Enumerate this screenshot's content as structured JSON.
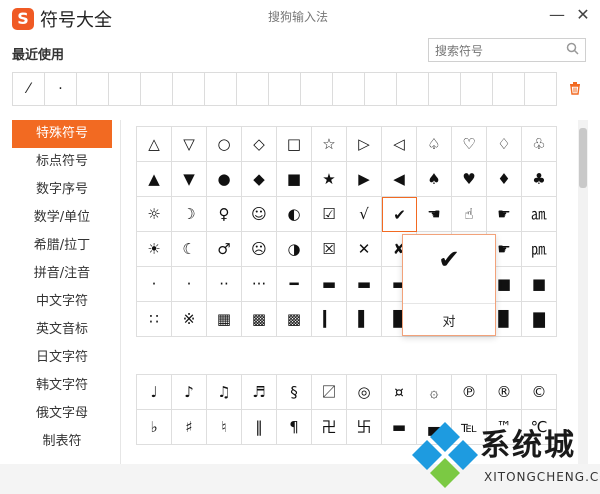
{
  "title_bar": {
    "logo_letter": "S",
    "app_title": "符号大全",
    "ime_name": "搜狗输入法",
    "minimize_glyph": "—",
    "close_glyph": "✕"
  },
  "recent": {
    "label": "最近使用",
    "items": [
      "⁄",
      "·",
      "",
      "",
      "",
      "",
      "",
      "",
      "",
      "",
      "",
      "",
      "",
      "",
      "",
      "",
      ""
    ]
  },
  "search": {
    "placeholder": "搜索符号",
    "icon": "search-icon"
  },
  "categories": [
    {
      "label": "特殊符号",
      "active": true
    },
    {
      "label": "标点符号",
      "active": false
    },
    {
      "label": "数字序号",
      "active": false
    },
    {
      "label": "数学/单位",
      "active": false
    },
    {
      "label": "希腊/拉丁",
      "active": false
    },
    {
      "label": "拼音/注音",
      "active": false
    },
    {
      "label": "中文字符",
      "active": false
    },
    {
      "label": "英文音标",
      "active": false
    },
    {
      "label": "日文字符",
      "active": false
    },
    {
      "label": "韩文字符",
      "active": false
    },
    {
      "label": "俄文字母",
      "active": false
    },
    {
      "label": "制表符",
      "active": false
    }
  ],
  "grid1": [
    "△",
    "▽",
    "○",
    "◇",
    "□",
    "☆",
    "▷",
    "◁",
    "♤",
    "♡",
    "♢",
    "♧",
    "▲",
    "▼",
    "●",
    "◆",
    "■",
    "★",
    "▶",
    "◀",
    "♠",
    "♥",
    "♦",
    "♣",
    "☼",
    "☽",
    "♀",
    "☺",
    "◐",
    "☑",
    "√",
    "✔",
    "☚",
    "☝",
    "☛",
    "㏂",
    "☀",
    "☾",
    "♂",
    "☹",
    "◑",
    "☒",
    "✕",
    "✘",
    "",
    "",
    "☛",
    "㏘",
    "·",
    "·",
    "··",
    "···",
    "━",
    "▬",
    "▬",
    "▬",
    "",
    "",
    "■",
    "■",
    "∷",
    "※",
    "▦",
    "▩",
    "▩",
    "▎",
    "▌",
    "▊",
    "",
    "",
    "▉",
    "▇"
  ],
  "grid2": [
    "♩",
    "♪",
    "♫",
    "♬",
    "§",
    "〼",
    "◎",
    "¤",
    "۞",
    "℗",
    "®",
    "©",
    "♭",
    "♯",
    "♮",
    "‖",
    "¶",
    "卍",
    "卐",
    "▬",
    "▄",
    "℡",
    "™",
    "℃"
  ],
  "popup": {
    "glyph": "✔",
    "meaning": "对"
  },
  "watermark": {
    "title": "系统城",
    "subtitle": "XITONGCHENG.COM"
  },
  "colors": {
    "accent": "#f26a22",
    "logo": "#f05a24",
    "watermark_blue": "#1e9be0"
  }
}
